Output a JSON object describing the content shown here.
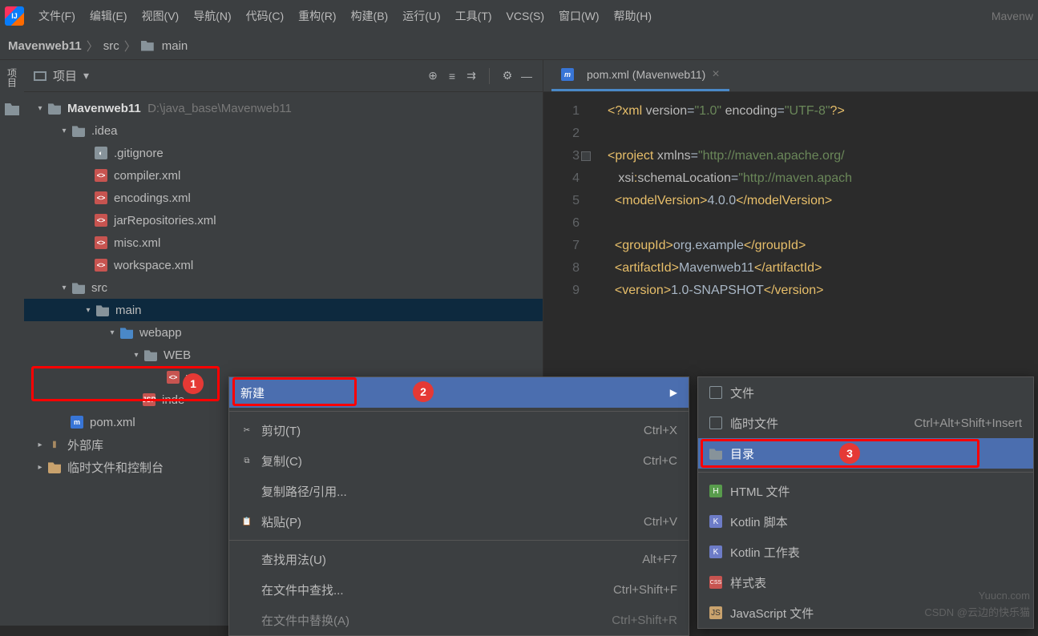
{
  "menu": {
    "items": [
      "文件(F)",
      "编辑(E)",
      "视图(V)",
      "导航(N)",
      "代码(C)",
      "重构(R)",
      "构建(B)",
      "运行(U)",
      "工具(T)",
      "VCS(S)",
      "窗口(W)",
      "帮助(H)"
    ],
    "right": "Mavenw"
  },
  "breadcrumb": {
    "project": "Mavenweb11",
    "p1": "src",
    "p2": "main"
  },
  "panel": {
    "title": "项目"
  },
  "tree": {
    "root": "Mavenweb11",
    "rootPath": "D:\\java_base\\Mavenweb11",
    "idea": ".idea",
    "files": [
      ".gitignore",
      "compiler.xml",
      "encodings.xml",
      "jarRepositories.xml",
      "misc.xml",
      "workspace.xml"
    ],
    "src": "src",
    "main": "main",
    "webapp": "webapp",
    "webinf": "WEB",
    "w": "w",
    "indexjsp": "inde",
    "pom": "pom.xml",
    "external": "外部库",
    "scratch": "临时文件和控制台"
  },
  "tab": {
    "label": "pom.xml (Mavenweb11)"
  },
  "code": {
    "l1": "<?xml version=\"1.0\" encoding=\"UTF-8\"?>",
    "l3a": "<project ",
    "l3b": "xmlns",
    "l3c": "=\"http://maven.apache.org/",
    "l4a": "xsi",
    "l4b": ":schemaLocation",
    "l4c": "=\"http://maven.apach",
    "l5": "<modelVersion>4.0.0</modelVersion>",
    "l7": "<groupId>org.example</groupId>",
    "l8": "<artifactId>Mavenweb11</artifactId>",
    "l9": "<version>1.0-SNAPSHOT</version>"
  },
  "ctx1": {
    "new": "新建",
    "cut": "剪切(T)",
    "cut_k": "Ctrl+X",
    "copy": "复制(C)",
    "copy_k": "Ctrl+C",
    "copypath": "复制路径/引用...",
    "paste": "粘贴(P)",
    "paste_k": "Ctrl+V",
    "findusage": "查找用法(U)",
    "findusage_k": "Alt+F7",
    "findinfiles": "在文件中查找...",
    "findinfiles_k": "Ctrl+Shift+F",
    "replaceinfiles": "在文件中替换(A)",
    "replaceinfiles_k": "Ctrl+Shift+R"
  },
  "ctx2": {
    "file": "文件",
    "scratch": "临时文件",
    "scratch_k": "Ctrl+Alt+Shift+Insert",
    "dir": "目录",
    "html": "HTML 文件",
    "kotlinscript": "Kotlin 脚本",
    "kotlinws": "Kotlin 工作表",
    "stylesheet": "样式表",
    "js": "JavaScript 文件"
  },
  "badges": {
    "b1": "1",
    "b2": "2",
    "b3": "3"
  },
  "watermark": "Yuucn.com",
  "watermark2": "CSDN @云边的快乐猫"
}
